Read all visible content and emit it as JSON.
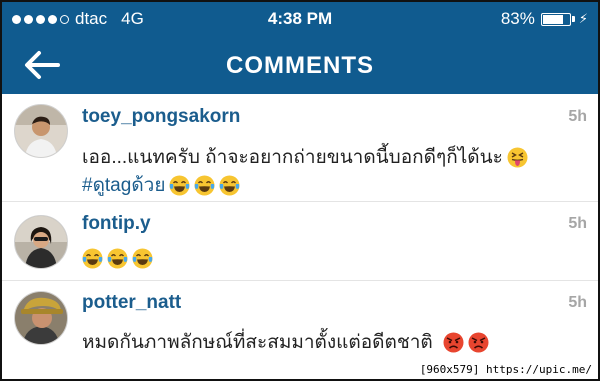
{
  "status_bar": {
    "carrier": "dtac",
    "network": "4G",
    "time": "4:38 PM",
    "battery_text": "83%",
    "battery_level": 0.83,
    "signal_bars_filled": 4,
    "signal_bars_total": 5
  },
  "nav": {
    "title": "COMMENTS",
    "back_icon": "arrow-left-icon"
  },
  "colors": {
    "brand": "#105b8f",
    "username": "#1b5d8d",
    "timestamp": "#a6a6a6"
  },
  "comments": [
    {
      "username": "toey_pongsakorn",
      "time": "5h",
      "line1": "เออ...แนทครับ ถ้าจะอยากถ่ายขนาดนี้บอกดีๆก็ได้นะ",
      "line1_emojis": [
        "squinting-tongue-face"
      ],
      "hashtag": "#ดูtagด้วย",
      "line2_emojis": [
        "crying-laughing-face",
        "crying-laughing-face",
        "crying-laughing-face"
      ]
    },
    {
      "username": "fontip.y",
      "time": "5h",
      "emojis": [
        "crying-laughing-face",
        "crying-laughing-face",
        "crying-laughing-face"
      ]
    },
    {
      "username": "potter_natt",
      "time": "5h",
      "line1": "หมดกันภาพลักษณ์ที่สะสมมาตั้งแต่อดีตชาติ",
      "emojis": [
        "angry-face",
        "angry-face"
      ]
    }
  ],
  "watermark": "[960x579] https://upic.me/"
}
